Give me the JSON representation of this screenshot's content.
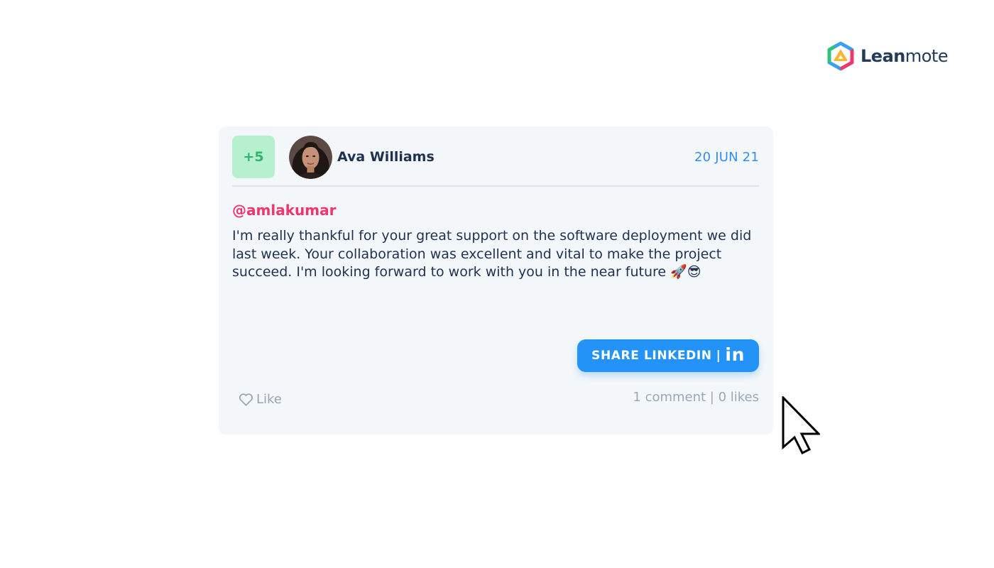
{
  "brand": {
    "name_bold": "Lean",
    "name_light": "mote",
    "icon": "leanmote-logo-icon"
  },
  "post": {
    "points": "+5",
    "author": "Ava Williams",
    "avatar_icon": "user-avatar",
    "date": "20 JUN 21",
    "mention": "@amlakumar",
    "message": "I'm really thankful for your great support on the software deployment we did last week. Your collaboration was excellent and vital to make the project succeed. I'm looking forward to work with you in the near future 🚀😎",
    "share_label": "SHARE LINKEDIN",
    "share_separator": "|",
    "share_icon_text": "in",
    "like_label": "Like",
    "stats": "1 comment | 0 likes"
  },
  "colors": {
    "accent": "#2493f7",
    "date": "#2e8fef",
    "mention": "#f0366c",
    "points_bg": "#b6f0cf",
    "points_text": "#2fb46d",
    "card_bg": "#f4f7fa",
    "text_dark": "#1e3150"
  }
}
